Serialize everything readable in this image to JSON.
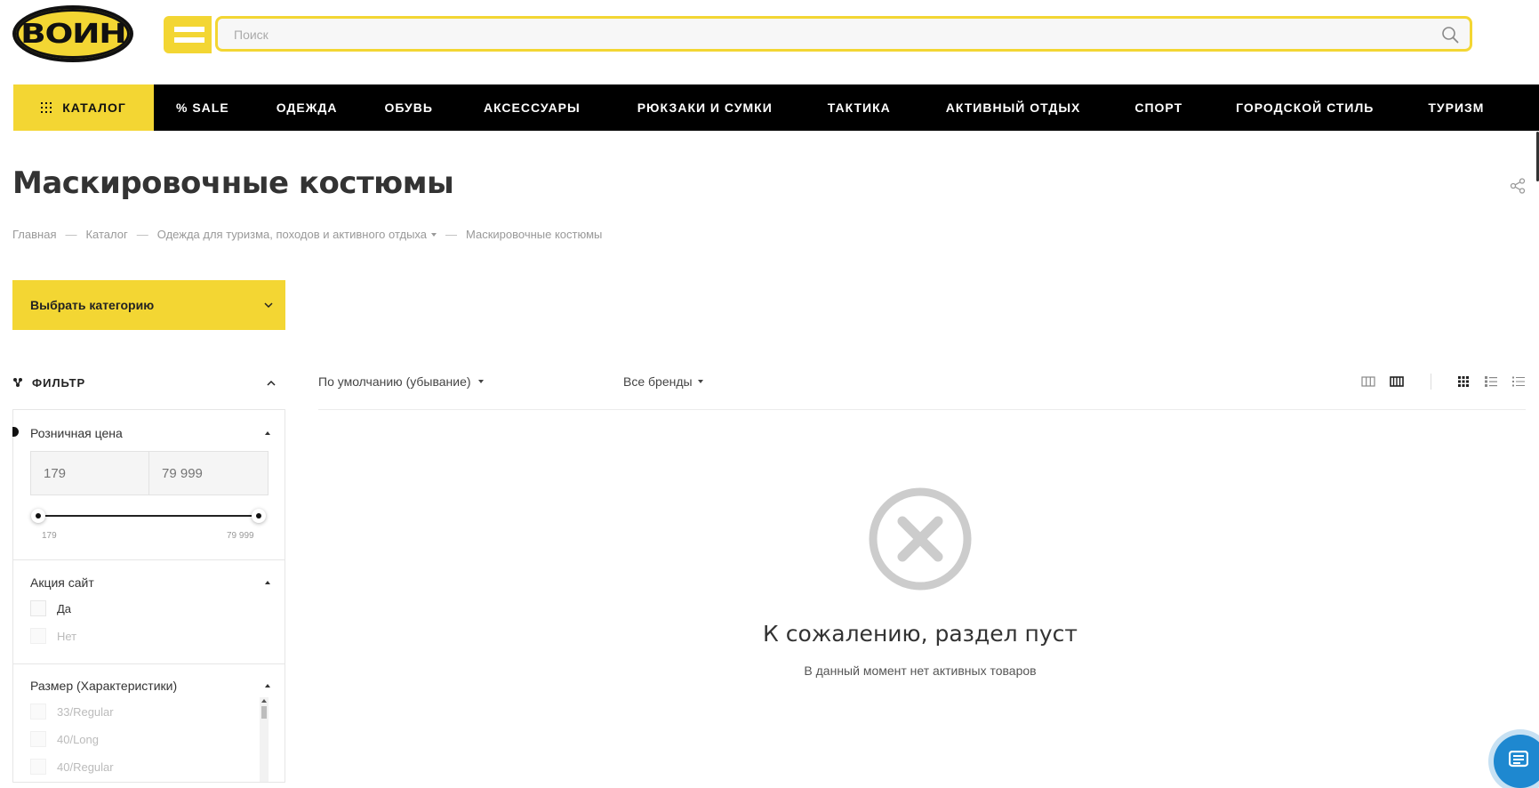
{
  "header": {
    "logo_text": "ВОИН",
    "search": {
      "placeholder": "Поиск",
      "value": ""
    }
  },
  "nav": {
    "catalog_label": "КАТАЛОГ",
    "items": [
      "% SALE",
      "ОДЕЖДА",
      "ОБУВЬ",
      "АКСЕССУАРЫ",
      "РЮКЗАКИ И СУМКИ",
      "ТАКТИКА",
      "АКТИВНЫЙ ОТДЫХ",
      "СПОРТ",
      "ГОРОДСКОЙ СТИЛЬ",
      "ТУРИЗМ"
    ]
  },
  "page": {
    "title": "Маскировочные костюмы",
    "breadcrumb": [
      "Главная",
      "Каталог",
      "Одежда для туризма, походов и активного отдыха",
      "Маскировочные костюмы"
    ]
  },
  "category_select": {
    "label": "Выбрать категорию"
  },
  "filter": {
    "title": "ФИЛЬТР",
    "price": {
      "title": "Розничная цена",
      "min_placeholder": "179",
      "max_placeholder": "79 999",
      "min_label": "179",
      "max_label": "79 999"
    },
    "promo": {
      "title": "Акция сайт",
      "options": [
        "Да",
        "Нет"
      ]
    },
    "size": {
      "title": "Размер (Характеристики)",
      "options": [
        "33/Regular",
        "40/Long",
        "40/Regular"
      ]
    }
  },
  "toolbar": {
    "sort_label": "По умолчанию (убывание)",
    "brands_label": "Все бренды"
  },
  "empty": {
    "title": "К сожалению, раздел пуст",
    "subtitle": "В данный момент нет активных товаров"
  },
  "colors": {
    "accent": "#f3d633",
    "nav_bg": "#000000",
    "chat": "#1e88d0"
  },
  "icons": [
    "search-icon",
    "grid-dots-icon",
    "filter-icon",
    "chevron-up-icon",
    "chevron-down-icon",
    "share-icon",
    "empty-x-icon",
    "chat-icon",
    "view-tile-icon",
    "view-list-icon"
  ]
}
